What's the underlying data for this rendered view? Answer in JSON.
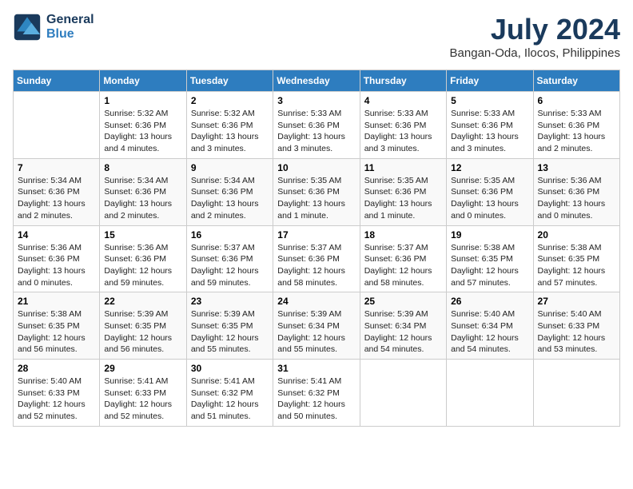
{
  "header": {
    "logo_line1": "General",
    "logo_line2": "Blue",
    "month": "July 2024",
    "location": "Bangan-Oda, Ilocos, Philippines"
  },
  "days_of_week": [
    "Sunday",
    "Monday",
    "Tuesday",
    "Wednesday",
    "Thursday",
    "Friday",
    "Saturday"
  ],
  "weeks": [
    [
      {
        "day": "",
        "sunrise": "",
        "sunset": "",
        "daylight": ""
      },
      {
        "day": "1",
        "sunrise": "Sunrise: 5:32 AM",
        "sunset": "Sunset: 6:36 PM",
        "daylight": "Daylight: 13 hours and 4 minutes."
      },
      {
        "day": "2",
        "sunrise": "Sunrise: 5:32 AM",
        "sunset": "Sunset: 6:36 PM",
        "daylight": "Daylight: 13 hours and 3 minutes."
      },
      {
        "day": "3",
        "sunrise": "Sunrise: 5:33 AM",
        "sunset": "Sunset: 6:36 PM",
        "daylight": "Daylight: 13 hours and 3 minutes."
      },
      {
        "day": "4",
        "sunrise": "Sunrise: 5:33 AM",
        "sunset": "Sunset: 6:36 PM",
        "daylight": "Daylight: 13 hours and 3 minutes."
      },
      {
        "day": "5",
        "sunrise": "Sunrise: 5:33 AM",
        "sunset": "Sunset: 6:36 PM",
        "daylight": "Daylight: 13 hours and 3 minutes."
      },
      {
        "day": "6",
        "sunrise": "Sunrise: 5:33 AM",
        "sunset": "Sunset: 6:36 PM",
        "daylight": "Daylight: 13 hours and 2 minutes."
      }
    ],
    [
      {
        "day": "7",
        "sunrise": "Sunrise: 5:34 AM",
        "sunset": "Sunset: 6:36 PM",
        "daylight": "Daylight: 13 hours and 2 minutes."
      },
      {
        "day": "8",
        "sunrise": "Sunrise: 5:34 AM",
        "sunset": "Sunset: 6:36 PM",
        "daylight": "Daylight: 13 hours and 2 minutes."
      },
      {
        "day": "9",
        "sunrise": "Sunrise: 5:34 AM",
        "sunset": "Sunset: 6:36 PM",
        "daylight": "Daylight: 13 hours and 2 minutes."
      },
      {
        "day": "10",
        "sunrise": "Sunrise: 5:35 AM",
        "sunset": "Sunset: 6:36 PM",
        "daylight": "Daylight: 13 hours and 1 minute."
      },
      {
        "day": "11",
        "sunrise": "Sunrise: 5:35 AM",
        "sunset": "Sunset: 6:36 PM",
        "daylight": "Daylight: 13 hours and 1 minute."
      },
      {
        "day": "12",
        "sunrise": "Sunrise: 5:35 AM",
        "sunset": "Sunset: 6:36 PM",
        "daylight": "Daylight: 13 hours and 0 minutes."
      },
      {
        "day": "13",
        "sunrise": "Sunrise: 5:36 AM",
        "sunset": "Sunset: 6:36 PM",
        "daylight": "Daylight: 13 hours and 0 minutes."
      }
    ],
    [
      {
        "day": "14",
        "sunrise": "Sunrise: 5:36 AM",
        "sunset": "Sunset: 6:36 PM",
        "daylight": "Daylight: 13 hours and 0 minutes."
      },
      {
        "day": "15",
        "sunrise": "Sunrise: 5:36 AM",
        "sunset": "Sunset: 6:36 PM",
        "daylight": "Daylight: 12 hours and 59 minutes."
      },
      {
        "day": "16",
        "sunrise": "Sunrise: 5:37 AM",
        "sunset": "Sunset: 6:36 PM",
        "daylight": "Daylight: 12 hours and 59 minutes."
      },
      {
        "day": "17",
        "sunrise": "Sunrise: 5:37 AM",
        "sunset": "Sunset: 6:36 PM",
        "daylight": "Daylight: 12 hours and 58 minutes."
      },
      {
        "day": "18",
        "sunrise": "Sunrise: 5:37 AM",
        "sunset": "Sunset: 6:36 PM",
        "daylight": "Daylight: 12 hours and 58 minutes."
      },
      {
        "day": "19",
        "sunrise": "Sunrise: 5:38 AM",
        "sunset": "Sunset: 6:35 PM",
        "daylight": "Daylight: 12 hours and 57 minutes."
      },
      {
        "day": "20",
        "sunrise": "Sunrise: 5:38 AM",
        "sunset": "Sunset: 6:35 PM",
        "daylight": "Daylight: 12 hours and 57 minutes."
      }
    ],
    [
      {
        "day": "21",
        "sunrise": "Sunrise: 5:38 AM",
        "sunset": "Sunset: 6:35 PM",
        "daylight": "Daylight: 12 hours and 56 minutes."
      },
      {
        "day": "22",
        "sunrise": "Sunrise: 5:39 AM",
        "sunset": "Sunset: 6:35 PM",
        "daylight": "Daylight: 12 hours and 56 minutes."
      },
      {
        "day": "23",
        "sunrise": "Sunrise: 5:39 AM",
        "sunset": "Sunset: 6:35 PM",
        "daylight": "Daylight: 12 hours and 55 minutes."
      },
      {
        "day": "24",
        "sunrise": "Sunrise: 5:39 AM",
        "sunset": "Sunset: 6:34 PM",
        "daylight": "Daylight: 12 hours and 55 minutes."
      },
      {
        "day": "25",
        "sunrise": "Sunrise: 5:39 AM",
        "sunset": "Sunset: 6:34 PM",
        "daylight": "Daylight: 12 hours and 54 minutes."
      },
      {
        "day": "26",
        "sunrise": "Sunrise: 5:40 AM",
        "sunset": "Sunset: 6:34 PM",
        "daylight": "Daylight: 12 hours and 54 minutes."
      },
      {
        "day": "27",
        "sunrise": "Sunrise: 5:40 AM",
        "sunset": "Sunset: 6:33 PM",
        "daylight": "Daylight: 12 hours and 53 minutes."
      }
    ],
    [
      {
        "day": "28",
        "sunrise": "Sunrise: 5:40 AM",
        "sunset": "Sunset: 6:33 PM",
        "daylight": "Daylight: 12 hours and 52 minutes."
      },
      {
        "day": "29",
        "sunrise": "Sunrise: 5:41 AM",
        "sunset": "Sunset: 6:33 PM",
        "daylight": "Daylight: 12 hours and 52 minutes."
      },
      {
        "day": "30",
        "sunrise": "Sunrise: 5:41 AM",
        "sunset": "Sunset: 6:32 PM",
        "daylight": "Daylight: 12 hours and 51 minutes."
      },
      {
        "day": "31",
        "sunrise": "Sunrise: 5:41 AM",
        "sunset": "Sunset: 6:32 PM",
        "daylight": "Daylight: 12 hours and 50 minutes."
      },
      {
        "day": "",
        "sunrise": "",
        "sunset": "",
        "daylight": ""
      },
      {
        "day": "",
        "sunrise": "",
        "sunset": "",
        "daylight": ""
      },
      {
        "day": "",
        "sunrise": "",
        "sunset": "",
        "daylight": ""
      }
    ]
  ]
}
